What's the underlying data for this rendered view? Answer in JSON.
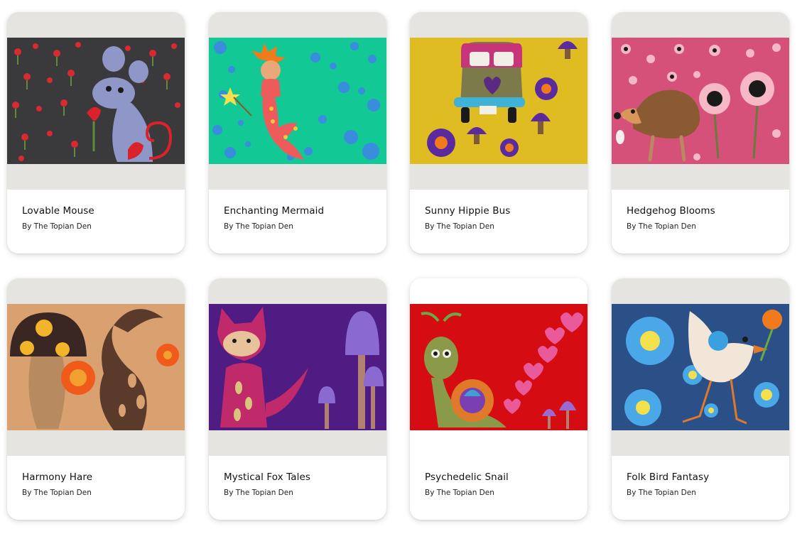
{
  "gallery": {
    "cards": [
      {
        "title": "Lovable Mouse",
        "author": "By The Topian Den",
        "bg": "#3a393c",
        "art": "mouse-illustration"
      },
      {
        "title": "Enchanting Mermaid",
        "author": "By The Topian Den",
        "bg": "#12c995",
        "art": "mermaid-illustration"
      },
      {
        "title": "Sunny Hippie Bus",
        "author": "By The Topian Den",
        "bg": "#dfbd22",
        "art": "hippie-bus-illustration"
      },
      {
        "title": "Hedgehog Blooms",
        "author": "By The Topian Den",
        "bg": "#d6517a",
        "art": "hedgehog-illustration"
      },
      {
        "title": "Harmony Hare",
        "author": "By The Topian Den",
        "bg": "#d9a070",
        "art": "hare-illustration"
      },
      {
        "title": "Mystical Fox Tales",
        "author": "By The Topian Den",
        "bg": "#4e1c82",
        "art": "fox-illustration"
      },
      {
        "title": "Psychedelic Snail",
        "author": "By The Topian Den",
        "bg": "#d50d12",
        "art": "snail-illustration"
      },
      {
        "title": "Folk Bird Fantasy",
        "author": "By The Topian Den",
        "bg": "#2b4f87",
        "art": "bird-illustration"
      }
    ]
  }
}
